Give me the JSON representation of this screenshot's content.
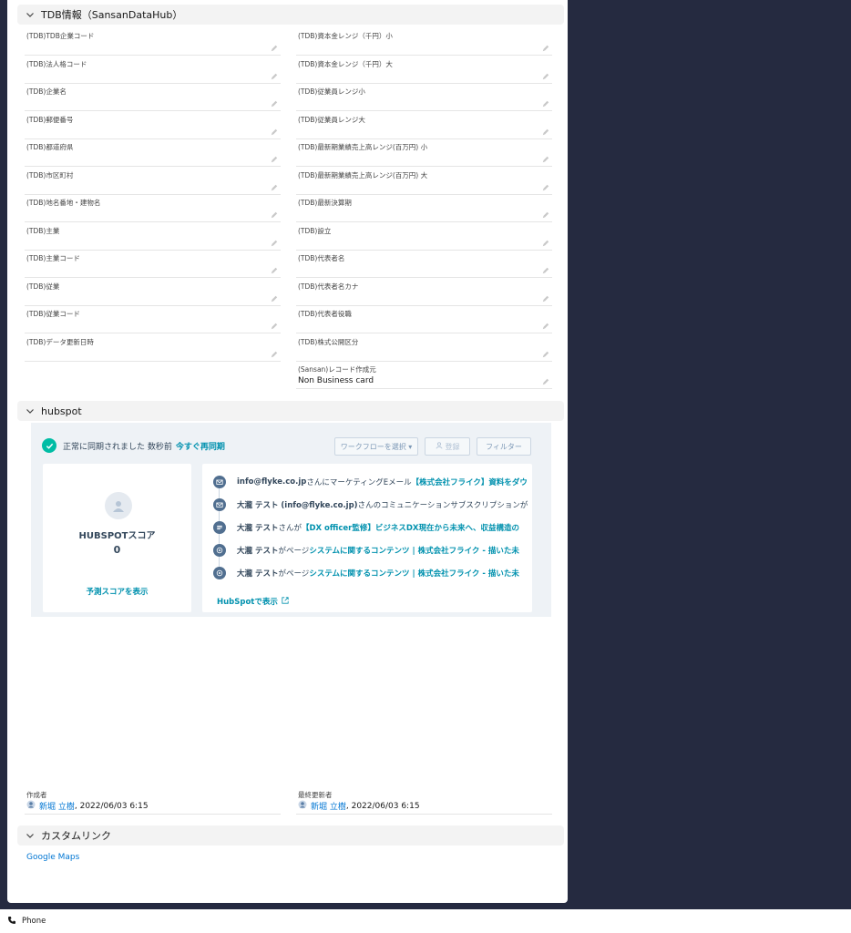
{
  "tdb_section": {
    "title": "TDB情報（SansanDataHub）",
    "left_fields": [
      {
        "label": "(TDB)TDB企業コード",
        "value": ""
      },
      {
        "label": "(TDB)法人格コード",
        "value": ""
      },
      {
        "label": "(TDB)企業名",
        "value": ""
      },
      {
        "label": "(TDB)郵便番号",
        "value": ""
      },
      {
        "label": "(TDB)都道府県",
        "value": ""
      },
      {
        "label": "(TDB)市区町村",
        "value": ""
      },
      {
        "label": "(TDB)地名番地・建物名",
        "value": ""
      },
      {
        "label": "(TDB)主業",
        "value": ""
      },
      {
        "label": "(TDB)主業コード",
        "value": ""
      },
      {
        "label": "(TDB)従業",
        "value": ""
      },
      {
        "label": "(TDB)従業コード",
        "value": ""
      },
      {
        "label": "(TDB)データ更新日時",
        "value": ""
      }
    ],
    "right_fields": [
      {
        "label": "(TDB)資本金レンジ（千円）小",
        "value": ""
      },
      {
        "label": "(TDB)資本金レンジ（千円）大",
        "value": ""
      },
      {
        "label": "(TDB)従業員レンジ小",
        "value": ""
      },
      {
        "label": "(TDB)従業員レンジ大",
        "value": ""
      },
      {
        "label": "(TDB)最新期業績売上高レンジ(百万円) 小",
        "value": ""
      },
      {
        "label": "(TDB)最新期業績売上高レンジ(百万円) 大",
        "value": ""
      },
      {
        "label": "(TDB)最新決算期",
        "value": ""
      },
      {
        "label": "(TDB)設立",
        "value": ""
      },
      {
        "label": "(TDB)代表者名",
        "value": ""
      },
      {
        "label": "(TDB)代表者名カナ",
        "value": ""
      },
      {
        "label": "(TDB)代表者役職",
        "value": ""
      },
      {
        "label": "(TDB)株式公開区分",
        "value": ""
      },
      {
        "label": "(Sansan)レコード作成元",
        "value": "Non Business card"
      }
    ]
  },
  "hubspot_section": {
    "title": "hubspot",
    "status_text": "正常に同期されました 数秒前",
    "resync_link": "今すぐ再同期",
    "workflow_button": "ワークフローを選択 ▾",
    "register_button": "登録",
    "filter_button": "フィルター",
    "score_title": "HUBSPOTスコア",
    "score_value": "0",
    "score_link": "予測スコアを表示",
    "timeline": [
      {
        "icon": "email-icon",
        "bold": "info@flyke.co.jp",
        "text": "さんにマーケティングEメール",
        "link": "【株式会社フライク】資料をダウ"
      },
      {
        "icon": "email-icon",
        "bold": "大瀧 テスト (info@flyke.co.jp)",
        "text": "さんのコミュニケーションサブスクリプションが",
        "link": ""
      },
      {
        "icon": "form-icon",
        "bold": "大瀧 テスト",
        "text": "さんが",
        "link": "【DX officer監修】ビジネスDX現在から未来へ、収益構造の"
      },
      {
        "icon": "pageview-icon",
        "bold": "大瀧 テスト",
        "text": "がページ",
        "link": "システムに関するコンテンツ | 株式会社フライク - 描いた未"
      },
      {
        "icon": "pageview-icon",
        "bold": "大瀧 テスト",
        "text": "がページ",
        "link": "システムに関するコンテンツ | 株式会社フライク - 描いた未"
      }
    ],
    "view_in_hubspot": "HubSpotで表示"
  },
  "meta": {
    "created_by_label": "作成者",
    "created_by_user": "新堀 立樹",
    "created_by_date": ", 2022/06/03 6:15",
    "modified_by_label": "最終更新者",
    "modified_by_user": "新堀 立樹",
    "modified_by_date": ", 2022/06/03 6:15"
  },
  "custom_links": {
    "title": "カスタムリンク",
    "items": [
      "Google Maps"
    ]
  },
  "footer": {
    "phone_label": "Phone"
  },
  "colors": {
    "background": "#252a40",
    "hubspot_teal": "#00bda5",
    "hubspot_link": "#0091ae",
    "sf_link": "#0176d3"
  }
}
